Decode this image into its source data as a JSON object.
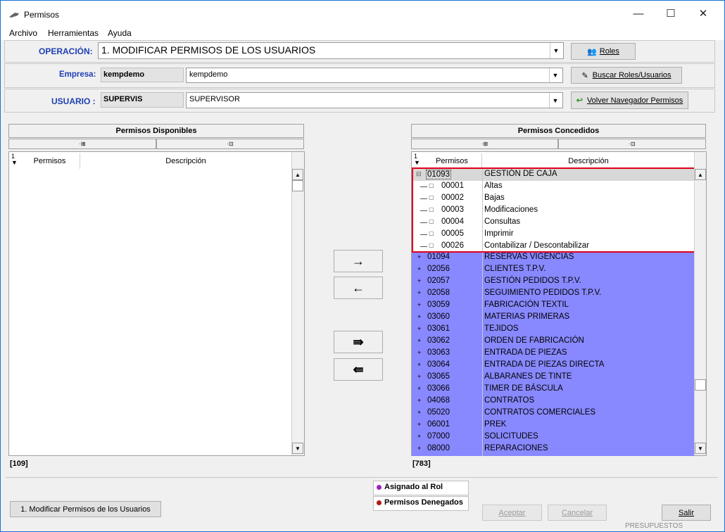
{
  "window": {
    "title": "Permisos",
    "controls": {
      "minimize": "—",
      "maximize": "☐",
      "close": "✕"
    }
  },
  "menu": [
    "Archivo",
    "Herramientas",
    "Ayuda"
  ],
  "operacion": {
    "label": "OPERACIÓN:",
    "value": "1. MODIFICAR PERMISOS DE LOS USUARIOS",
    "button": "Roles"
  },
  "empresa": {
    "label": "Empresa:",
    "code": "kempdemo",
    "value": "kempdemo",
    "button": "Buscar Roles/Usuarios"
  },
  "usuario": {
    "label": "USUARIO :",
    "code": "SUPERVIS",
    "value": "SUPERVISOR",
    "button": "Volver Navegador Permisos"
  },
  "disponibles": {
    "title": "Permisos Disponibles",
    "sub_left": "·⊞",
    "sub_right": "·⊡",
    "sort": "1",
    "col_permisos": "Permisos",
    "col_descripcion": "Descripción",
    "count": "[109]"
  },
  "concedidos": {
    "title": "Permisos Concedidos",
    "sub_left": "·⊞",
    "sub_right": "·⊡",
    "sort": "1",
    "col_permisos": "Permisos",
    "col_descripcion": "Descripción",
    "count": "[783]",
    "parent": {
      "code": "01093",
      "desc": "GESTIÓN DE CAJA"
    },
    "children": [
      {
        "code": "00001",
        "desc": "Altas"
      },
      {
        "code": "00002",
        "desc": "Bajas"
      },
      {
        "code": "00003",
        "desc": "Modificaciones"
      },
      {
        "code": "00004",
        "desc": "Consultas"
      },
      {
        "code": "00005",
        "desc": "Imprimir"
      },
      {
        "code": "00026",
        "desc": "Contabilizar / Descontabilizar"
      }
    ],
    "rows": [
      {
        "code": "01094",
        "desc": "RESERVAS VIGENCIAS"
      },
      {
        "code": "02056",
        "desc": "CLIENTES T.P.V."
      },
      {
        "code": "02057",
        "desc": "GESTIÓN PEDIDOS T.P.V."
      },
      {
        "code": "02058",
        "desc": "SEGUIMIENTO PEDIDOS T.P.V."
      },
      {
        "code": "03059",
        "desc": "FABRICACIÓN TEXTIL"
      },
      {
        "code": "03060",
        "desc": "MATERIAS PRIMERAS"
      },
      {
        "code": "03061",
        "desc": "TEJIDOS"
      },
      {
        "code": "03062",
        "desc": "ORDEN DE FABRICACIÓN"
      },
      {
        "code": "03063",
        "desc": "ENTRADA DE PIEZAS"
      },
      {
        "code": "03064",
        "desc": "ENTRADA DE PIEZAS DIRECTA"
      },
      {
        "code": "03065",
        "desc": "ALBARANES DE TINTE"
      },
      {
        "code": "03066",
        "desc": "TIMER DE BÁSCULA"
      },
      {
        "code": "04068",
        "desc": "CONTRATOS"
      },
      {
        "code": "05020",
        "desc": "CONTRATOS COMERCIALES"
      },
      {
        "code": "06001",
        "desc": "PREK"
      },
      {
        "code": "07000",
        "desc": "SOLICITUDES"
      },
      {
        "code": "08000",
        "desc": "REPARACIONES"
      }
    ]
  },
  "transfer": {
    "add": "→",
    "remove": "←",
    "add_all": "⇛",
    "remove_all": "⇚"
  },
  "legend": {
    "asignado": "Asignado al Rol",
    "denegados": "Permisos Denegados"
  },
  "footer": {
    "mode_button": "1. Modificar Permisos de los Usuarios",
    "aceptar": "Aceptar",
    "cancelar": "Cancelar",
    "salir": "Salir",
    "partial_text": "PRESUPUESTOS"
  },
  "colors": {
    "selection": "#8888ff",
    "label_blue": "#1f3fb5",
    "highlight_border": "#e0001b"
  }
}
